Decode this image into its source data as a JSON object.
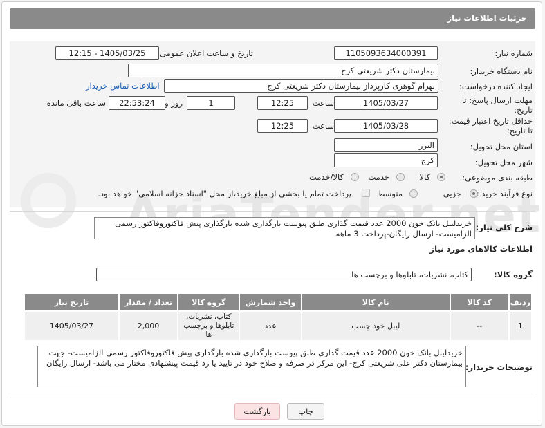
{
  "header": {
    "title": "جزئیات اطلاعات نیاز"
  },
  "form": {
    "need_number_label": "شماره نیاز:",
    "need_number": "1105093634000391",
    "announce_label": "تاریخ و ساعت اعلان عمومی:",
    "announce_value": "1405/03/25 - 12:15",
    "buyer_org_label": "نام دستگاه خریدار:",
    "buyer_org": "بیمارستان دکتر شریعتی کرج",
    "creator_label": "ایجاد کننده درخواست:",
    "creator": "بهرام گوهری کارپرداز بیمارستان دکتر شریعتی کرج",
    "contact_link": "اطلاعات تماس خریدار",
    "deadline_label": "مهلت ارسال پاسخ: تا تاریخ:",
    "deadline_date": "1405/03/27",
    "time_label": "ساعت",
    "deadline_time": "12:25",
    "days_value": "1",
    "days_label": "روز و",
    "remaining_time": "22:53:24",
    "remaining_label": "ساعت باقی مانده",
    "validity_label": "حداقل تاریخ اعتبار قیمت: تا تاریخ:",
    "validity_date": "1405/03/28",
    "validity_time": "12:25",
    "province_label": "استان محل تحویل:",
    "province": "البرز",
    "city_label": "شهر محل تحویل:",
    "city": "کرج",
    "category_label": "طبقه بندی موضوعی:",
    "category_options": [
      "کالا",
      "خدمت",
      "کالا/خدمت"
    ],
    "process_label": "نوع فرآیند خرید :",
    "process_options": [
      "جزیی",
      "متوسط"
    ],
    "payment_note": "پرداخت تمام یا بخشی از مبلغ خرید،از محل \"اسناد خزانه اسلامی\" خواهد بود."
  },
  "summary": {
    "label": "شرح کلی نیاز:",
    "text": "خریدلیبل بانک خون 2000 عدد قیمت گذاری  طبق پیوست بارگذاری شده بارگذاری پیش فاکتوروفاکتور رسمی الزامیست- ارسال رایگان-پرداخت 3 ماهه"
  },
  "goods": {
    "section_title": "اطلاعات کالاهای مورد نیاز",
    "group_label": "گروه کالا:",
    "group_value": "کتاب، نشریات، تابلوها و برچسب ها",
    "table": {
      "headers": [
        "ردیف",
        "کد کالا",
        "نام کالا",
        "واحد شمارش",
        "گروه کالا",
        "تعداد / مقدار",
        "تاریخ نیاز"
      ],
      "rows": [
        [
          "1",
          "--",
          "لیبل خود چسب",
          "عدد",
          "کتاب، نشریات، تابلوها و برچسب ها",
          "2,000",
          "1405/03/27"
        ]
      ]
    }
  },
  "buyer_notes": {
    "label": "توضیحات خریدار:",
    "text": "خریدلیبل بانک خون 2000 عدد قیمت گذاری     طبق پیوست بارگذاری شده بارگذاری پیش فاکتوروفاکتور رسمی الزامیست- جهت بیمارستان دکتر علی شریعتی کرج- این مرکز در صرفه و صلاح خود در تایید یا رد قیمت پیشنهادی مختار می باشد- ارسال رایگان"
  },
  "buttons": {
    "print": "چاپ",
    "back": "بازگشت"
  },
  "watermark": "AriaTender.net",
  "colors": {
    "header_bg": "#8a8a8a",
    "link": "#1a5fb4",
    "back_btn_bg": "#fbe3e3"
  }
}
